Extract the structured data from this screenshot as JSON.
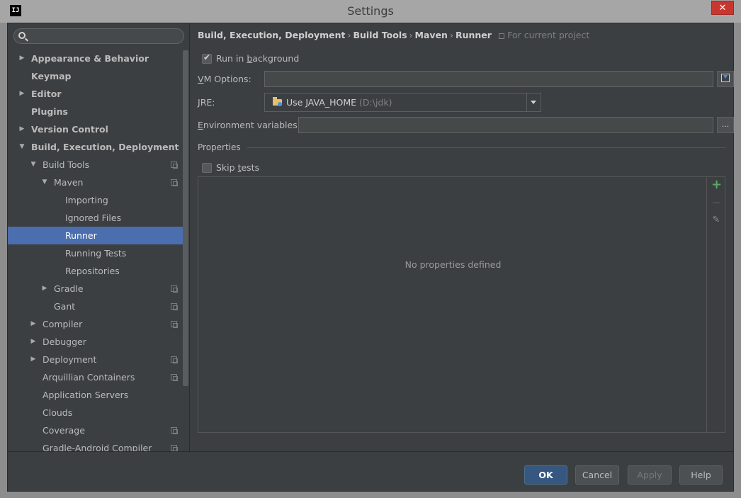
{
  "window": {
    "title": "Settings",
    "app_icon": "IJ",
    "close_label": "✕"
  },
  "search": {
    "placeholder": ""
  },
  "sidebar": {
    "items": [
      {
        "label": "Appearance & Behavior",
        "arrow": "▶",
        "bold": true
      },
      {
        "label": "Keymap",
        "bold": true
      },
      {
        "label": "Editor",
        "arrow": "▶",
        "bold": true
      },
      {
        "label": "Plugins",
        "bold": true
      },
      {
        "label": "Version Control",
        "arrow": "▶",
        "bold": true
      },
      {
        "label": "Build, Execution, Deployment",
        "arrow": "▼",
        "bold": true
      },
      {
        "label": "Build Tools",
        "arrow": "▼"
      },
      {
        "label": "Maven",
        "arrow": "▼"
      },
      {
        "label": "Importing"
      },
      {
        "label": "Ignored Files"
      },
      {
        "label": "Runner",
        "selected": true
      },
      {
        "label": "Running Tests"
      },
      {
        "label": "Repositories"
      },
      {
        "label": "Gradle",
        "arrow": "▶"
      },
      {
        "label": "Gant"
      },
      {
        "label": "Compiler",
        "arrow": "▶"
      },
      {
        "label": "Debugger",
        "arrow": "▶"
      },
      {
        "label": "Deployment",
        "arrow": "▶"
      },
      {
        "label": "Arquillian Containers"
      },
      {
        "label": "Application Servers"
      },
      {
        "label": "Clouds"
      },
      {
        "label": "Coverage"
      },
      {
        "label": "Gradle-Android Compiler"
      }
    ]
  },
  "breadcrumb": {
    "parts": [
      "Build, Execution, Deployment",
      "Build Tools",
      "Maven",
      "Runner"
    ],
    "separator": "›",
    "scope": "For current project"
  },
  "form": {
    "run_in_background": {
      "label_pre": "Run in ",
      "label_key": "b",
      "label_post": "ackground",
      "checked": true
    },
    "vm_options": {
      "label_key": "V",
      "label_post": "M Options:",
      "value": ""
    },
    "jre": {
      "label_key": "J",
      "label_post": "RE:",
      "value": "Use JAVA_HOME",
      "hint": "(D:\\jdk)"
    },
    "env_vars": {
      "label_key": "E",
      "label_post": "nvironment variables:",
      "value": "",
      "button": "..."
    },
    "properties_label": "Properties",
    "skip_tests": {
      "label_pre": "Skip ",
      "label_key": "t",
      "label_post": "ests",
      "checked": false
    },
    "table_empty": "No properties defined",
    "toolbar": {
      "add": "+",
      "remove": "—",
      "edit": "✎"
    }
  },
  "footer": {
    "ok": "OK",
    "cancel": "Cancel",
    "apply": "Apply",
    "help": "Help"
  },
  "colors": {
    "selection": "#4b6eaf",
    "background": "#3c3f41",
    "add_icon": "#59a869",
    "primary_button": "#365880"
  }
}
